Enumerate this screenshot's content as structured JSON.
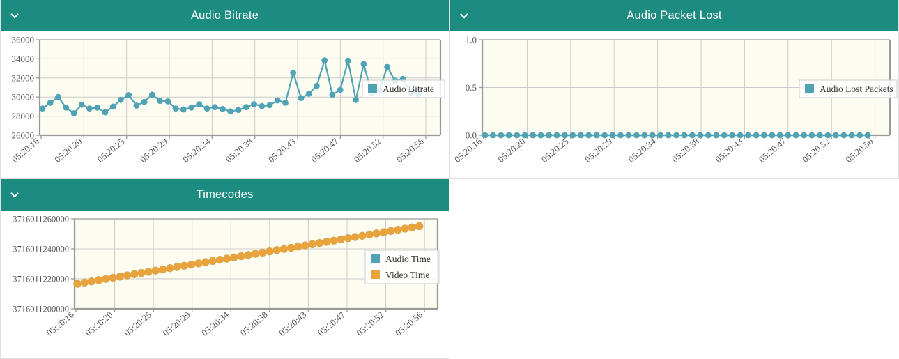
{
  "panels": [
    {
      "id": "audio-bitrate",
      "title": "Audio Bitrate",
      "collapse_icon": "chevron-down-icon",
      "chart_index": 0
    },
    {
      "id": "audio-packet-lost",
      "title": "Audio Packet Lost",
      "collapse_icon": "chevron-down-icon",
      "chart_index": 1
    },
    {
      "id": "timecodes",
      "title": "Timecodes",
      "collapse_icon": "chevron-down-icon",
      "chart_index": 2
    }
  ],
  "colors": {
    "header_teal": "#1d8c80",
    "series_teal": "#4fa3b4",
    "series_orange": "#e8a33d",
    "plot_background": "#fdfcf0",
    "grid": "#cccccc",
    "axis": "#999999",
    "panel_border": "#e0e0e0",
    "text": "#555555"
  },
  "chart_data": [
    {
      "type": "line",
      "title": "Audio Bitrate",
      "xlabel": "",
      "ylabel": "",
      "grid": true,
      "legend": [
        "Audio Bitrate"
      ],
      "legend_position": "center-right",
      "ylim": [
        26000,
        36000
      ],
      "yticks": [
        26000,
        28000,
        30000,
        32000,
        34000,
        36000
      ],
      "xticks": [
        "05:20:16",
        "05:20:20",
        "05:20:25",
        "05:20:29",
        "05:20:34",
        "05:20:38",
        "05:20:43",
        "05:20:47",
        "05:20:52",
        "05:20:56"
      ],
      "series": [
        {
          "name": "Audio Bitrate",
          "color": "#4fa3b4",
          "values": [
            28800,
            29400,
            30000,
            28900,
            28300,
            29200,
            28800,
            28900,
            28400,
            29000,
            29700,
            30200,
            29100,
            29500,
            30250,
            29600,
            29550,
            28800,
            28700,
            28900,
            29250,
            28800,
            28950,
            28750,
            28500,
            28650,
            28950,
            29250,
            29050,
            29150,
            29650,
            29400,
            32550,
            29900,
            30350,
            31150,
            33850,
            30250,
            30750,
            33800,
            29700,
            33450,
            30400,
            30700,
            33150,
            31700,
            31900,
            30450,
            30350
          ]
        }
      ]
    },
    {
      "type": "line",
      "title": "Audio Packet Lost",
      "xlabel": "",
      "ylabel": "",
      "grid": true,
      "legend": [
        "Audio Lost Packets"
      ],
      "legend_position": "center-right",
      "ylim": [
        0.0,
        1.0
      ],
      "yticks": [
        0.0,
        0.5,
        1.0
      ],
      "ytick_labels": [
        "0.0",
        "0.5",
        "1.0"
      ],
      "xticks": [
        "05:20:16",
        "05:20:20",
        "05:20:25",
        "05:20:29",
        "05:20:34",
        "05:20:38",
        "05:20:43",
        "05:20:47",
        "05:20:52",
        "05:20:56"
      ],
      "series": [
        {
          "name": "Audio Lost Packets",
          "color": "#4fa3b4",
          "values": [
            0,
            0,
            0,
            0,
            0,
            0,
            0,
            0,
            0,
            0,
            0,
            0,
            0,
            0,
            0,
            0,
            0,
            0,
            0,
            0,
            0,
            0,
            0,
            0,
            0,
            0,
            0,
            0,
            0,
            0,
            0,
            0,
            0,
            0,
            0,
            0,
            0,
            0,
            0,
            0,
            0,
            0,
            0,
            0,
            0,
            0,
            0,
            0,
            0
          ]
        }
      ]
    },
    {
      "type": "line",
      "title": "Timecodes",
      "xlabel": "",
      "ylabel": "",
      "grid": true,
      "legend": [
        "Audio Time",
        "Video Time"
      ],
      "legend_position": "center-right",
      "ylim": [
        3716011200000,
        3716011260000
      ],
      "yticks": [
        3716011200000,
        3716011220000,
        3716011240000,
        3716011260000
      ],
      "ytick_labels": [
        "3716011200000",
        "3716011220000",
        "3716011240000",
        "3716011260000"
      ],
      "xticks": [
        "05:20:16",
        "05:20:20",
        "05:20:25",
        "05:20:29",
        "05:20:34",
        "05:20:38",
        "05:20:43",
        "05:20:47",
        "05:20:52",
        "05:20:56"
      ],
      "series": [
        {
          "name": "Audio Time",
          "color": "#4fa3b4",
          "values": [
            3716011216700,
            3716011217500,
            3716011218300,
            3716011219100,
            3716011219900,
            3716011220700,
            3716011221500,
            3716011222300,
            3716011223100,
            3716011223900,
            3716011224700,
            3716011225500,
            3716011226300,
            3716011227100,
            3716011227900,
            3716011228700,
            3716011229500,
            3716011230300,
            3716011231100,
            3716011231900,
            3716011232700,
            3716011233500,
            3716011234300,
            3716011235100,
            3716011235900,
            3716011236700,
            3716011237500,
            3716011238300,
            3716011239100,
            3716011239900,
            3716011240700,
            3716011241500,
            3716011242300,
            3716011243100,
            3716011243900,
            3716011244700,
            3716011245500,
            3716011246300,
            3716011247100,
            3716011247900,
            3716011248700,
            3716011249500,
            3716011250300,
            3716011251100,
            3716011251900,
            3716011252700,
            3716011253500,
            3716011254300,
            3716011255100
          ]
        },
        {
          "name": "Video Time",
          "color": "#e8a33d",
          "values": [
            3716011216700,
            3716011217500,
            3716011218300,
            3716011219100,
            3716011219900,
            3716011220700,
            3716011221500,
            3716011222300,
            3716011223100,
            3716011223900,
            3716011224700,
            3716011225500,
            3716011226300,
            3716011227100,
            3716011227900,
            3716011228700,
            3716011229500,
            3716011230300,
            3716011231100,
            3716011231900,
            3716011232700,
            3716011233500,
            3716011234300,
            3716011235100,
            3716011235900,
            3716011236700,
            3716011237500,
            3716011238300,
            3716011239100,
            3716011239900,
            3716011240700,
            3716011241500,
            3716011242300,
            3716011243100,
            3716011243900,
            3716011244700,
            3716011245500,
            3716011246300,
            3716011247100,
            3716011247900,
            3716011248700,
            3716011249500,
            3716011250300,
            3716011251100,
            3716011251900,
            3716011252700,
            3716011253500,
            3716011254300,
            3716011255100
          ]
        }
      ]
    }
  ]
}
